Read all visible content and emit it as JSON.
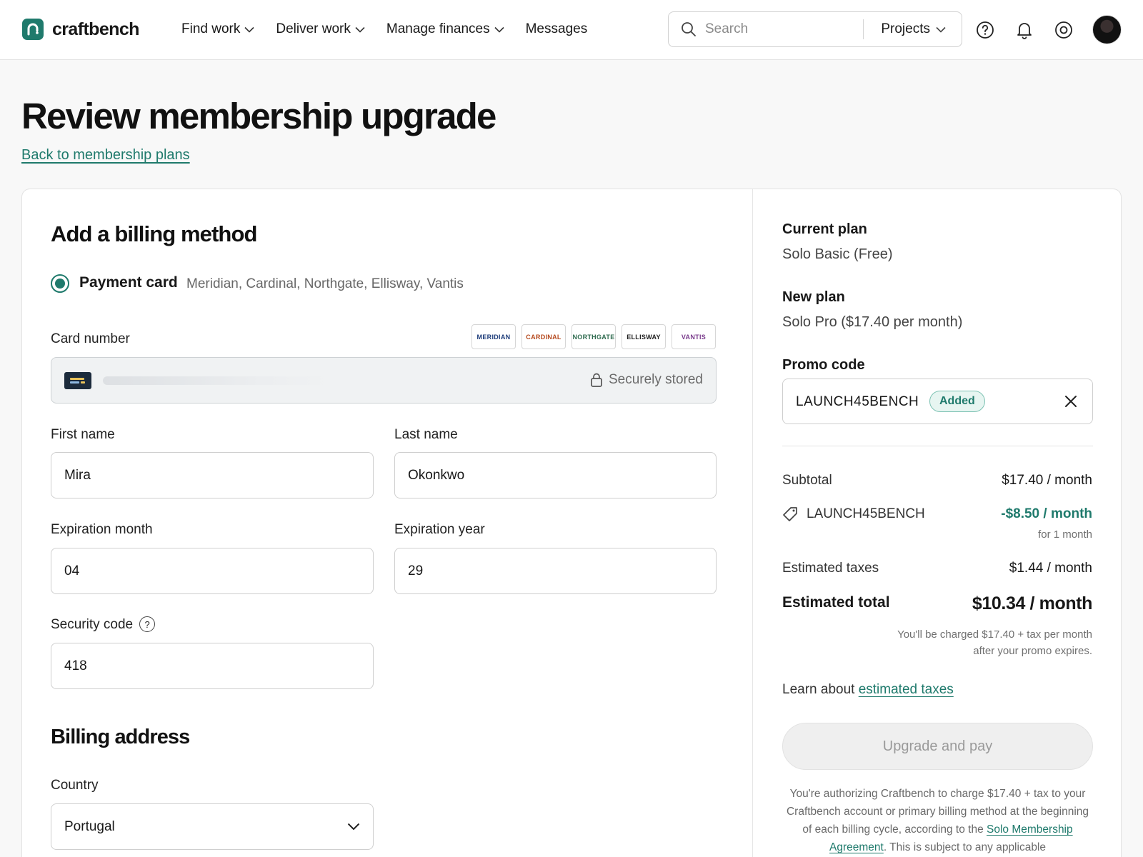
{
  "brand": {
    "name": "craftbench",
    "accent": "#1f7a6c"
  },
  "nav": {
    "items": [
      {
        "label": "Find work",
        "has_menu": true
      },
      {
        "label": "Deliver work",
        "has_menu": true
      },
      {
        "label": "Manage finances",
        "has_menu": true
      },
      {
        "label": "Messages",
        "has_menu": false
      }
    ],
    "search_placeholder": "Search",
    "search_scope": "Projects",
    "icons": [
      "help-icon",
      "bell-icon",
      "settings-icon"
    ]
  },
  "page": {
    "title": "Review membership upgrade",
    "back_link": "Back to membership plans"
  },
  "billing": {
    "heading": "Add a billing method",
    "method_label": "Payment card",
    "method_brands": "Meridian, Cardinal, Northgate, Ellisway, Vantis",
    "card_number_label": "Card number",
    "brand_badges": [
      {
        "label": "MERIDIAN",
        "color": "#1d3c7a"
      },
      {
        "label": "CARDINAL",
        "color": "#b5481c"
      },
      {
        "label": "NORTHGATE",
        "color": "#2f6b4f"
      },
      {
        "label": "ELLISWAY",
        "color": "#222222"
      },
      {
        "label": "VANTIS",
        "color": "#7a3c8c"
      }
    ],
    "card_status": "Securely stored",
    "first_name_label": "First name",
    "first_name": "Mira",
    "last_name_label": "Last name",
    "last_name": "Okonkwo",
    "exp_month_label": "Expiration month",
    "exp_month": "04",
    "exp_year_label": "Expiration year",
    "exp_year": "29",
    "cvc_label": "Security code",
    "cvc": "418",
    "address_heading": "Billing address",
    "country_label": "Country",
    "country": "Portugal"
  },
  "summary": {
    "current_plan_label": "Current plan",
    "current_plan": "Solo Basic (Free)",
    "new_plan_label": "New plan",
    "new_plan": "Solo Pro ($17.40 per month)",
    "promo_label": "Promo code",
    "promo_code": "LAUNCH45BENCH",
    "promo_status": "Added",
    "subtotal_label": "Subtotal",
    "subtotal": "$17.40 / month",
    "discount_label": "LAUNCH45BENCH",
    "discount": "-$8.50 / month",
    "discount_duration": "for 1 month",
    "taxes_label": "Estimated taxes",
    "taxes": "$1.44 / month",
    "total_label": "Estimated total",
    "total": "$10.34 / month",
    "charge_note": "You'll be charged $17.40 + tax per month after your promo expires.",
    "learn_prefix": "Learn about",
    "learn_link": "estimated taxes",
    "pay_button": "Upgrade and pay",
    "auth_prefix": "You're authorizing Craftbench to charge $17.40 + tax to your Craftbench account or primary billing method at the beginning of each billing cycle, according to the",
    "auth_link": "Solo Membership Agreement",
    "auth_suffix": ". This is subject to any applicable"
  }
}
